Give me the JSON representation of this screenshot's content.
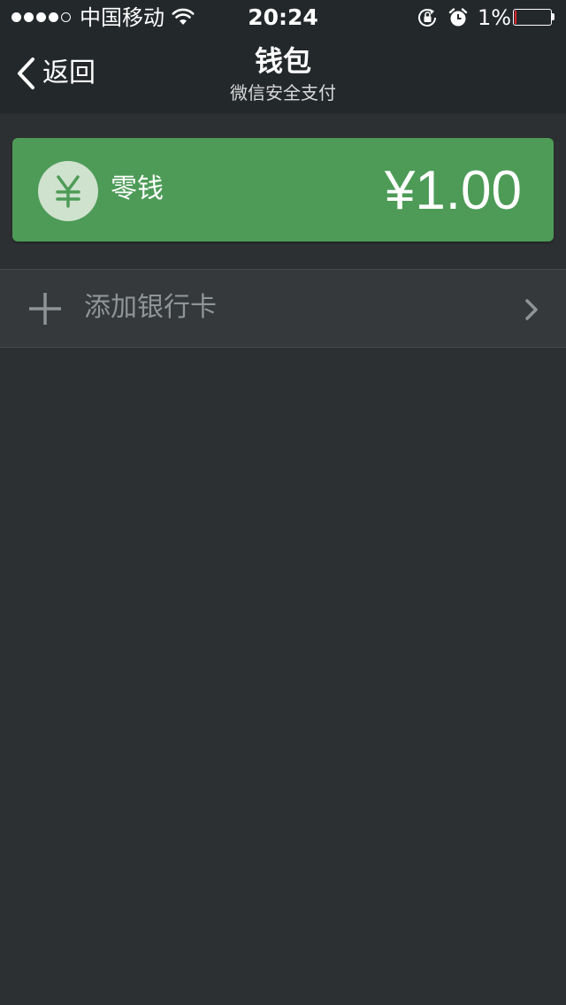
{
  "status_bar": {
    "carrier": "中国移动",
    "time": "20:24",
    "battery_percent": "1%",
    "signal_bars_filled": 4,
    "signal_bars_total": 5
  },
  "navbar": {
    "back_label": "返回",
    "title": "钱包",
    "subtitle": "微信安全支付"
  },
  "balance_card": {
    "icon": "yen-icon",
    "label": "零钱",
    "amount": "¥1.00"
  },
  "add_card_row": {
    "icon": "plus-icon",
    "label": "添加银行卡"
  },
  "colors": {
    "background": "#2d3032",
    "topbar": "#23282b",
    "card_green": "#4d9b57",
    "row_background": "#35393b",
    "muted_text": "#8f9496"
  }
}
